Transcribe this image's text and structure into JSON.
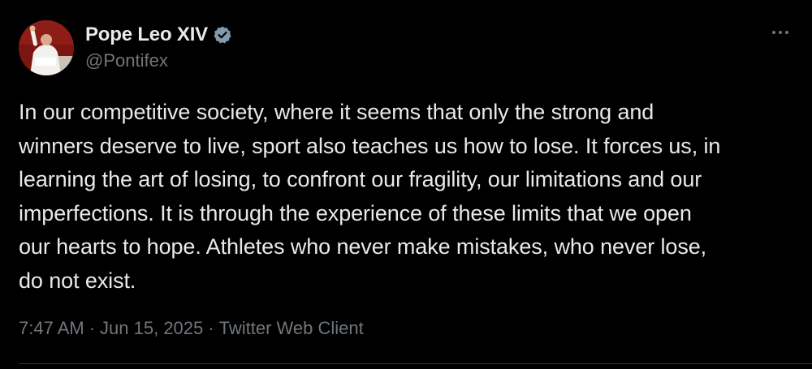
{
  "author": {
    "display_name": "Pope Leo XIV",
    "handle": "@Pontifex",
    "verified_color": "#829aab"
  },
  "tweet": {
    "text": "In our competitive society, where it seems that only the strong and\nwinners deserve to live, sport also teaches us how to lose. It forces us, in\nlearning the art of losing, to confront our fragility, our limitations and our\nimperfections. It is through the experience of these limits that we open\nour hearts to hope. Athletes who never make mistakes, who never lose,\ndo not exist."
  },
  "meta": {
    "time": "7:47 AM",
    "separator": "·",
    "date": "Jun 15, 2025",
    "source": "Twitter Web Client"
  },
  "icons": {
    "avatar": "avatar-photo",
    "verified": "verified-badge-icon",
    "more": "more-options-icon"
  },
  "colors": {
    "background": "#000000",
    "primary_text": "#e7e9ea",
    "secondary_text": "#71767b",
    "avatar_bg": "#7a1512"
  }
}
